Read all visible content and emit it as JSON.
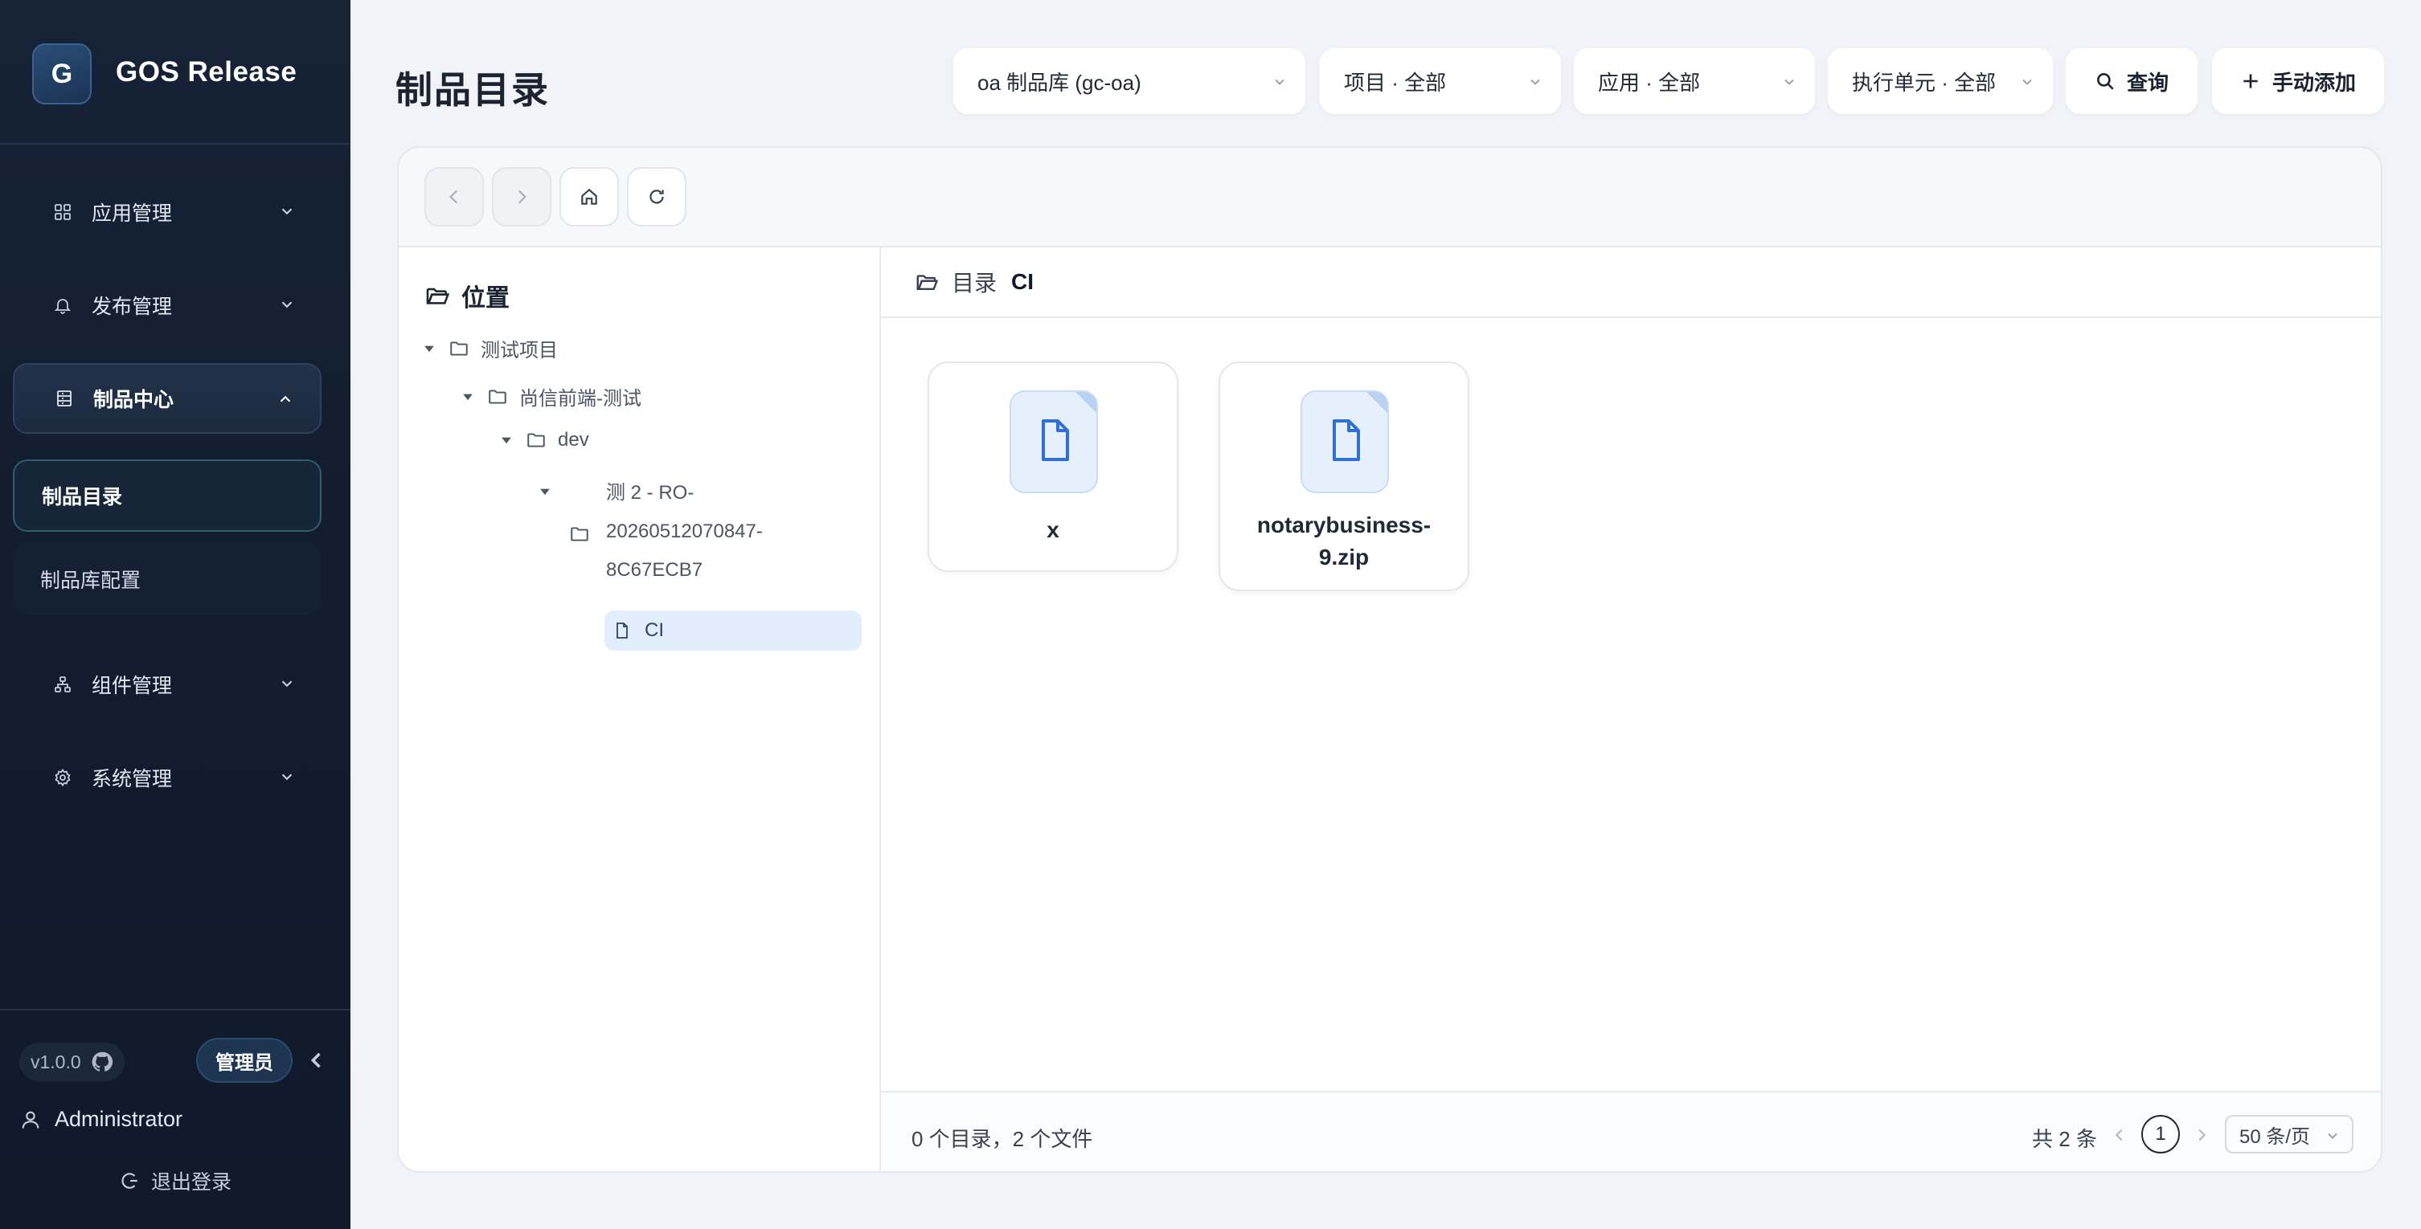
{
  "brand": {
    "logo_letter": "G",
    "title": "GOS Release"
  },
  "sidebar": {
    "groups": [
      {
        "label": "应用管理",
        "icon": "grid-icon"
      },
      {
        "label": "发布管理",
        "icon": "bell-icon"
      },
      {
        "label": "制品中心",
        "icon": "archive-icon"
      },
      {
        "label": "组件管理",
        "icon": "network-icon"
      },
      {
        "label": "系统管理",
        "icon": "gear-icon"
      }
    ],
    "sub_items": [
      {
        "label": "制品目录"
      },
      {
        "label": "制品库配置"
      }
    ],
    "version": "v1.0.0",
    "role": "管理员",
    "user": "Administrator",
    "logout": "退出登录"
  },
  "header": {
    "page_title": "制品目录",
    "filters": {
      "repo": "oa 制品库 (gc-oa)",
      "project": "项目 · 全部",
      "app": "应用 · 全部",
      "unit": "执行单元 · 全部"
    },
    "search_label": "查询",
    "add_label": "手动添加"
  },
  "tree": {
    "title": "位置",
    "nodes": [
      {
        "label": "测试项目"
      },
      {
        "label": "尚信前端-测试"
      },
      {
        "label": "dev"
      },
      {
        "label_lines": [
          "测 2 - RO-",
          "20260512070847-",
          "8C67ECB7"
        ]
      },
      {
        "label": "CI"
      }
    ]
  },
  "content": {
    "crumb_root": "目录",
    "crumb_current": "CI",
    "files": [
      {
        "name": "x"
      },
      {
        "name_lines": [
          "notarybusiness-",
          "9.zip"
        ]
      }
    ]
  },
  "footer": {
    "summary": "0 个目录，2 个文件",
    "total": "共 2 条",
    "page": "1",
    "page_size": "50 条/页"
  },
  "colors": {
    "sidebar_bg": "#111c2e",
    "accent": "#2f6fd6",
    "selected_bg": "#e3eefc"
  }
}
